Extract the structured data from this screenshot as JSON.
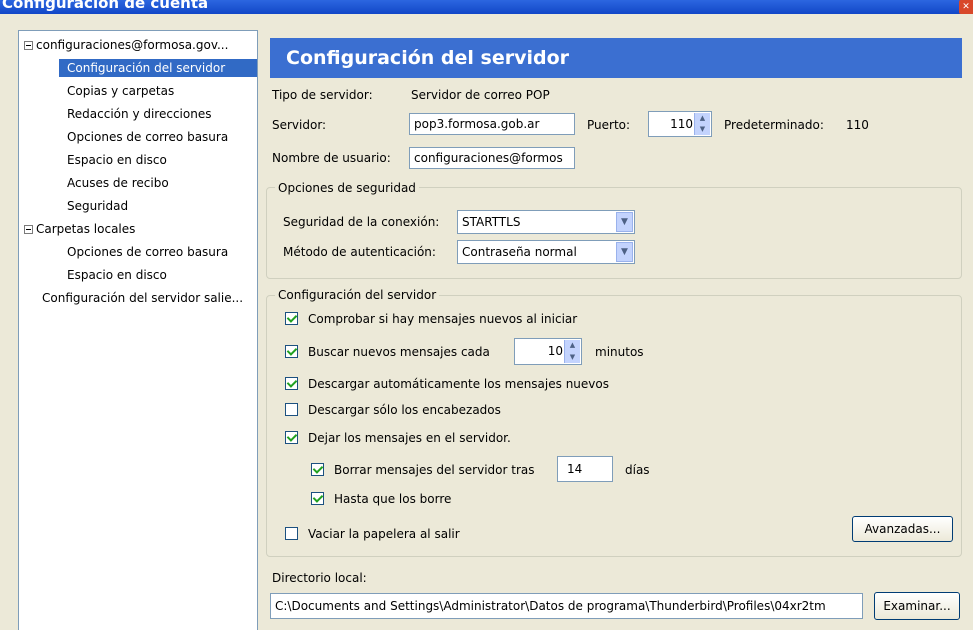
{
  "window": {
    "title": "Configuración de cuenta"
  },
  "sidebar": {
    "items": [
      {
        "label": "configuraciones@formosa.gov...",
        "expander": true
      },
      {
        "label": "Configuración del servidor",
        "selected": true
      },
      {
        "label": "Copias y carpetas"
      },
      {
        "label": "Redacción y direcciones"
      },
      {
        "label": "Opciones de correo basura"
      },
      {
        "label": "Espacio en disco"
      },
      {
        "label": "Acuses de recibo"
      },
      {
        "label": "Seguridad"
      },
      {
        "label": "Carpetas locales",
        "expander": true
      },
      {
        "label": "Opciones de correo basura"
      },
      {
        "label": "Espacio en disco"
      },
      {
        "label": "Configuración del servidor salie..."
      }
    ]
  },
  "main": {
    "header": "Configuración del servidor",
    "server_type_label": "Tipo de servidor:",
    "server_type_value": "Servidor de correo POP",
    "server_label": "Servidor:",
    "server_value": "pop3.formosa.gob.ar",
    "port_label": "Puerto:",
    "port_value": "110",
    "default_label": "Predeterminado:",
    "default_value": "110",
    "username_label": "Nombre de usuario:",
    "username_value": "configuraciones@formos",
    "security": {
      "legend": "Opciones de seguridad",
      "conn_label": "Seguridad de la conexión:",
      "conn_value": "STARTTLS",
      "auth_label": "Método de autenticación:",
      "auth_value": "Contraseña normal"
    },
    "server_settings": {
      "legend": "Configuración del servidor",
      "check_new_label": "Comprobar si hay mensajes nuevos al iniciar",
      "check_every_label": "Buscar nuevos mensajes cada",
      "check_every_value": "10",
      "minutes_label": "minutos",
      "auto_download_label": "Descargar automáticamente los mensajes nuevos",
      "headers_only_label": "Descargar sólo los encabezados",
      "leave_on_server_label": "Dejar los mensajes en el servidor.",
      "delete_after_label": "Borrar mensajes del servidor tras",
      "delete_after_value": "14",
      "days_label": "días",
      "until_delete_label": "Hasta que los borre",
      "empty_trash_label": "Vaciar la papelera al salir",
      "advanced_button": "Avanzadas..."
    },
    "local_dir_label": "Directorio local:",
    "local_dir_value": "C:\\Documents and Settings\\Administrator\\Datos de programa\\Thunderbird\\Profiles\\04xr2tm",
    "browse_button": "Examinar..."
  }
}
